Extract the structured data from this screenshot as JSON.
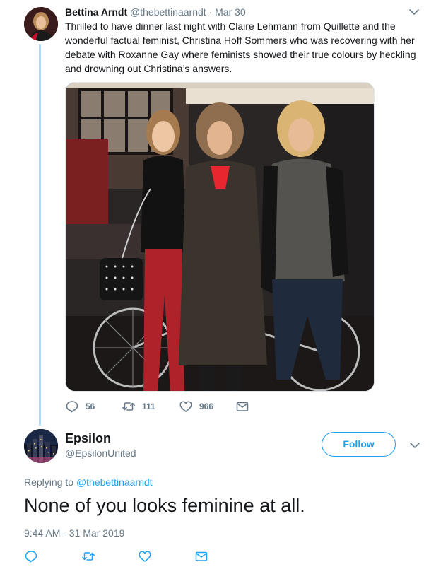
{
  "tweet1": {
    "author_name": "Bettina Arndt",
    "author_handle": "@thebettinaarndt",
    "separator": "·",
    "date": "Mar 30",
    "text": "Thrilled to have dinner last night with Claire Lehmann from Quillette and the wonderful factual feminist, Christina Hoff Sommers who was recovering with her debate with Roxanne Gay where feminists showed their true colours by heckling and drowning out Christina’s answers.",
    "actions": {
      "replies": "56",
      "retweets": "111",
      "likes": "966"
    }
  },
  "tweet2": {
    "author_name": "Epsilon",
    "author_handle": "@EpsilonUnited",
    "follow_label": "Follow",
    "replying_prefix": "Replying to",
    "replying_to": "@thebettinaarndt",
    "text": "None of you looks feminine at all.",
    "timestamp": "9:44 AM - 31 Mar 2019"
  },
  "colors": {
    "accent": "#1da1f2",
    "secondary_text": "#657786",
    "thread_line": "#aad8f5"
  },
  "icons": {
    "reply": "reply-icon",
    "retweet": "retweet-icon",
    "like": "heart-icon",
    "dm": "envelope-icon",
    "more": "chevron-down-icon"
  }
}
